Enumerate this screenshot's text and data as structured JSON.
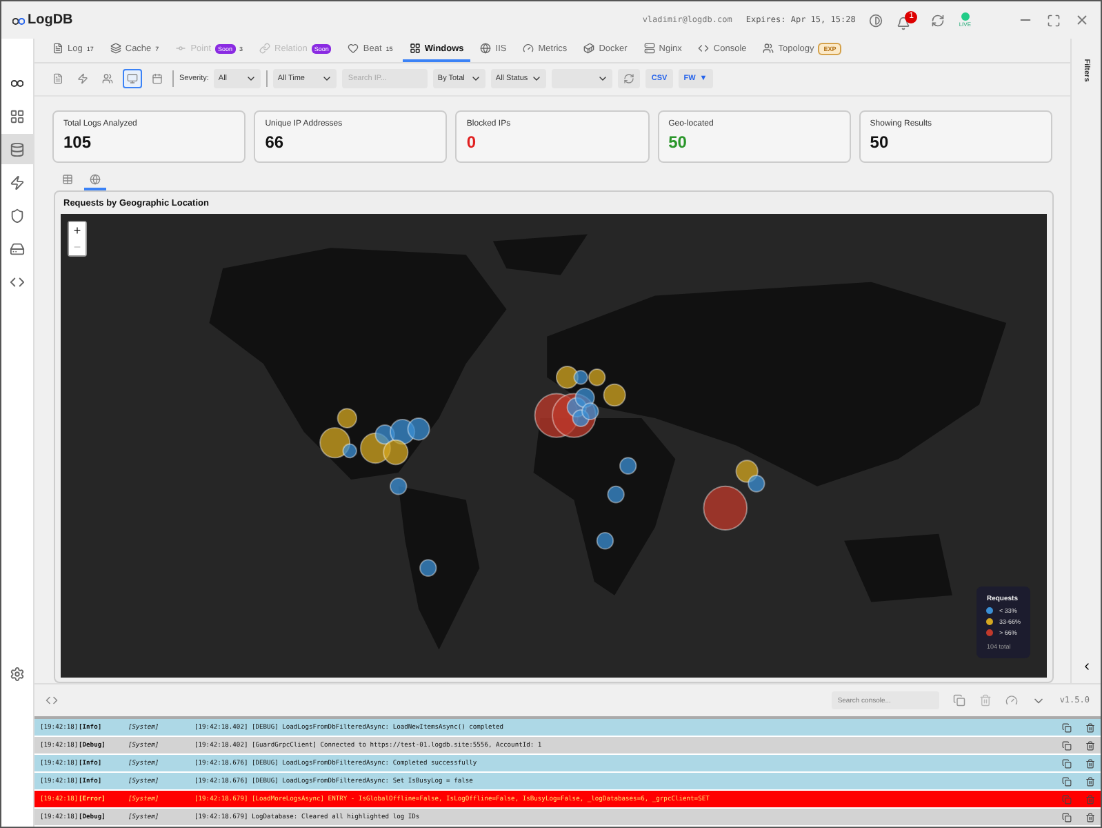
{
  "window": {
    "logo": "LogDB",
    "user": "vladimir@logdb.com",
    "expires": "Expires: Apr 15, 15:28",
    "notifications": "1",
    "live": "LIVE"
  },
  "sidebar": {
    "items": [
      {
        "selected": false
      },
      {
        "selected": true
      },
      {
        "selected": false
      },
      {
        "selected": false
      },
      {
        "selected": false
      },
      {
        "selected": false
      }
    ]
  },
  "tabs": [
    {
      "label": "Log",
      "count": "17",
      "selected": false,
      "disabled": false
    },
    {
      "label": "Cache",
      "count": "7",
      "selected": false,
      "disabled": false
    },
    {
      "label": "Point",
      "badge": "Soon",
      "count": "3",
      "selected": false,
      "disabled": true
    },
    {
      "label": "Relation",
      "badge": "Soon",
      "selected": false,
      "disabled": true
    },
    {
      "label": "Beat",
      "count": "15",
      "selected": false,
      "disabled": false
    },
    {
      "label": "Windows",
      "selected": true,
      "disabled": false
    },
    {
      "label": "IIS",
      "selected": false,
      "disabled": false
    },
    {
      "label": "Metrics",
      "selected": false,
      "disabled": false
    },
    {
      "label": "Docker",
      "selected": false,
      "disabled": false
    },
    {
      "label": "Nginx",
      "selected": false,
      "disabled": false
    },
    {
      "label": "Console",
      "selected": false,
      "disabled": false
    },
    {
      "label": "Topology",
      "tag": "EXP",
      "selected": false,
      "disabled": false
    }
  ],
  "toolbar": {
    "views": [
      {
        "selected": false
      },
      {
        "selected": false
      },
      {
        "selected": false
      },
      {
        "selected": true
      },
      {
        "selected": false
      }
    ],
    "severity_label": "Severity:",
    "severity": "All",
    "time": "All Time",
    "search": {
      "placeholder": "Search IP..."
    },
    "sort": "By Total",
    "status": "All Status",
    "csv": "CSV",
    "fw": "FW",
    "fw_caret": "▼"
  },
  "filters_label": "Filters",
  "stats": [
    {
      "label": "Total Logs Analyzed",
      "value": "105",
      "kind": "plain"
    },
    {
      "label": "Unique IP Addresses",
      "value": "66",
      "kind": "plain"
    },
    {
      "label": "Blocked IPs",
      "value": "0",
      "kind": "danger"
    },
    {
      "label": "Geo-located",
      "value": "50",
      "kind": "success"
    },
    {
      "label": "Showing Results",
      "value": "50",
      "kind": "plain"
    }
  ],
  "view_tabs": [
    {
      "selected": false
    },
    {
      "selected": true
    }
  ],
  "map": {
    "title": "Requests by Geographic Location",
    "zoom_in": "+",
    "zoom_out": "−",
    "legend": {
      "title": "Requests",
      "items": [
        {
          "label": "< 33%",
          "color": "#3b8fd4"
        },
        {
          "label": "33-66%",
          "color": "#d4a720"
        },
        {
          "label": "> 66%",
          "color": "#c0392b"
        }
      ],
      "total": "104 total"
    }
  },
  "console": {
    "search": {
      "placeholder": "Search console..."
    },
    "version": "v1.5.0",
    "rows": [
      {
        "time": "[19:42:18]",
        "level": "[Info]",
        "source": "[System]",
        "message": "[19:42:18.402] [DEBUG] LoadLogsFromDbFilteredAsync: LoadNewItemsAsync() completed"
      },
      {
        "time": "[19:42:18]",
        "level": "[Debug]",
        "source": "[System]",
        "message": "[19:42:18.402] [GuardGrpcClient] Connected to https://test-01.logdb.site:5556, AccountId: 1"
      },
      {
        "time": "[19:42:18]",
        "level": "[Info]",
        "source": "[System]",
        "message": "[19:42:18.676] [DEBUG] LoadLogsFromDbFilteredAsync: Completed successfully"
      },
      {
        "time": "[19:42:18]",
        "level": "[Info]",
        "source": "[System]",
        "message": "[19:42:18.676] [DEBUG] LoadLogsFromDbFilteredAsync: Set IsBusyLog = false"
      },
      {
        "time": "[19:42:18]",
        "level": "[Error]",
        "source": "[System]",
        "message": "[19:42:18.679] [LoadMoreLogsAsync] ENTRY - IsGlobalOffline=False, IsLogOffline=False, IsBusyLog=False, _logDatabases=6, _grpcClient=SET"
      },
      {
        "time": "[19:42:18]",
        "level": "[Debug]",
        "source": "[System]",
        "message": "[19:42:18.679] LogDatabase: Cleared all highlighted log IDs"
      }
    ]
  }
}
